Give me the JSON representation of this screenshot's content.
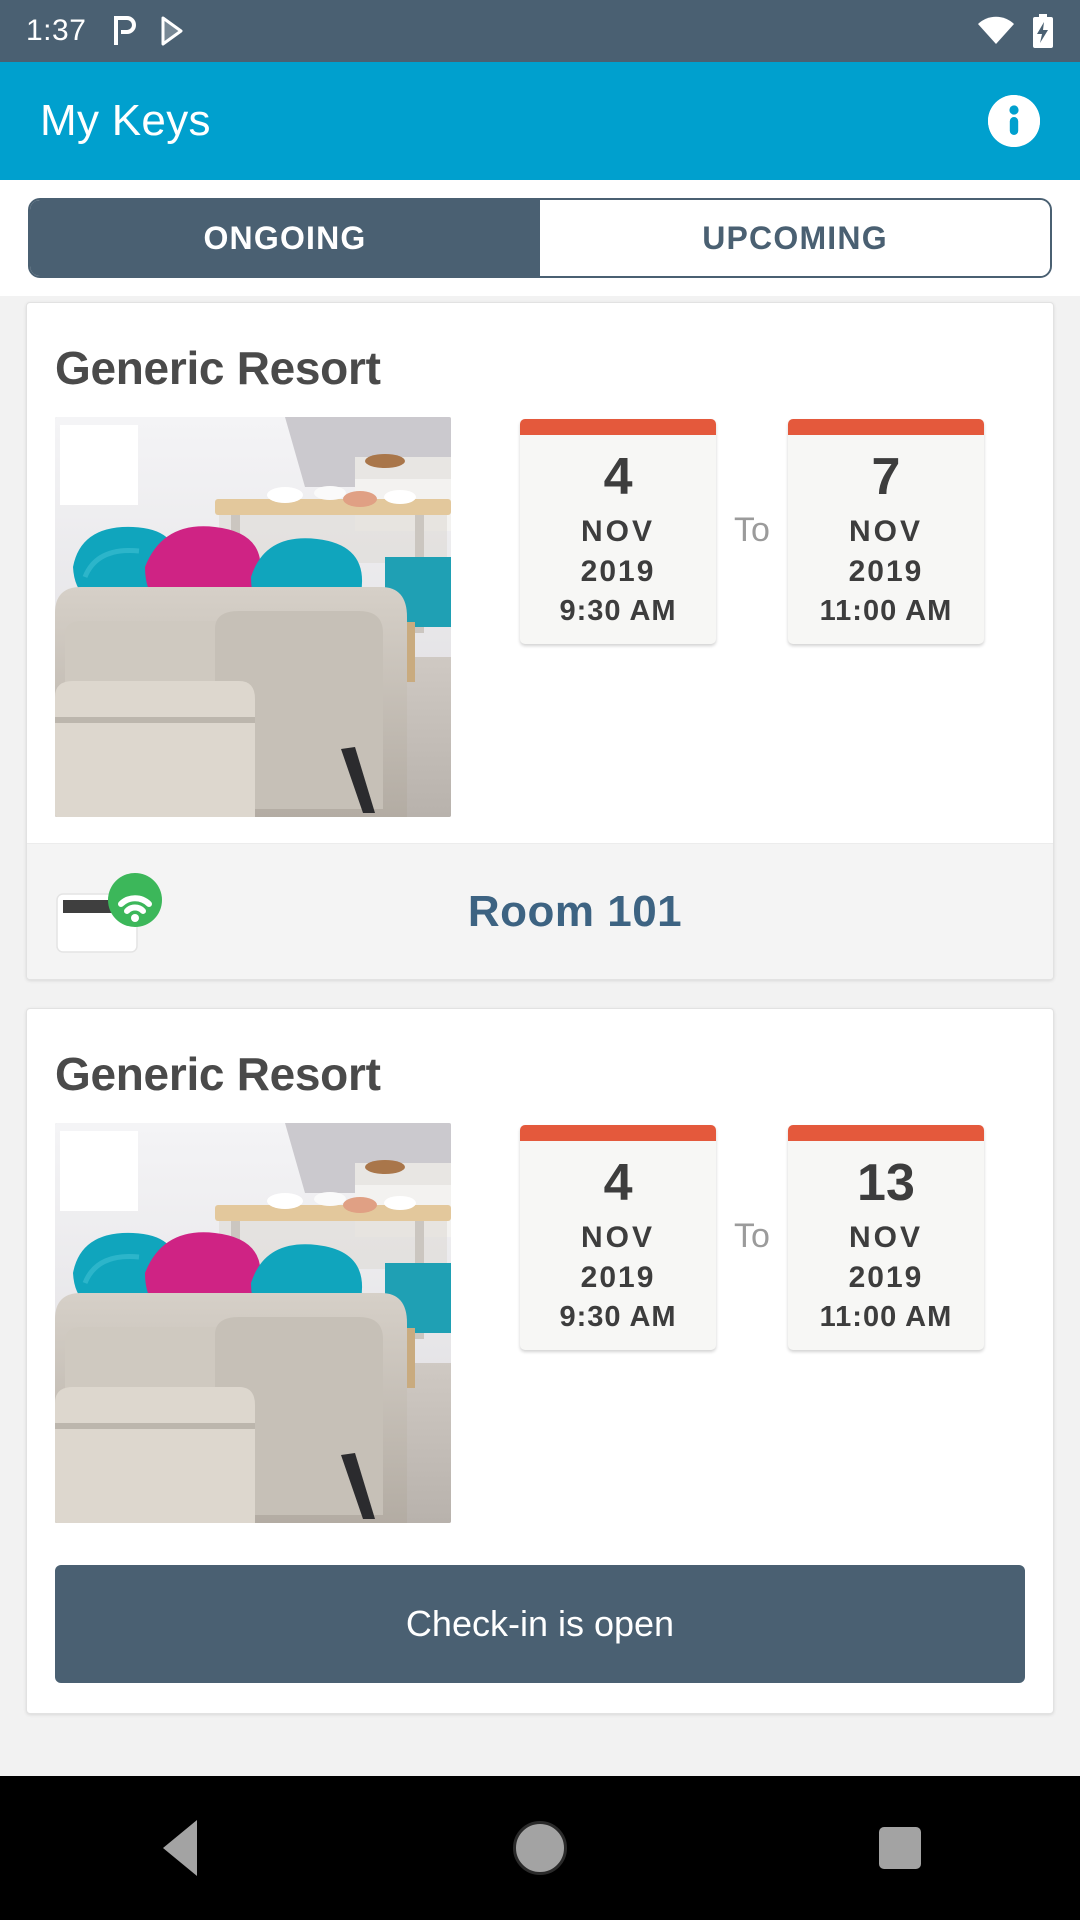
{
  "status_bar": {
    "time": "1:37",
    "left_icons": [
      "pocket-casts-icon",
      "play-store-icon"
    ],
    "right_icons": [
      "wifi-icon",
      "battery-charging-icon"
    ]
  },
  "app_bar": {
    "title": "My Keys",
    "info_icon": "info-icon",
    "background_color": "#00a0ce"
  },
  "tabs": {
    "items": [
      {
        "label": "ONGOING",
        "selected": true
      },
      {
        "label": "UPCOMING",
        "selected": false
      }
    ],
    "selected_color": "#4a6072",
    "unselected_text_color": "#4a6072"
  },
  "bookings": [
    {
      "property_name": "Generic Resort",
      "thumbnail": "living-room-photo",
      "separator_label": "To",
      "start": {
        "day": "4",
        "month": "NOV",
        "year": "2019",
        "time": "9:30 AM"
      },
      "end": {
        "day": "7",
        "month": "NOV",
        "year": "2019",
        "time": "11:00 AM"
      },
      "key": {
        "icon": "keycard-nfc-icon",
        "room_label": "Room 101"
      }
    },
    {
      "property_name": "Generic Resort",
      "thumbnail": "living-room-photo",
      "separator_label": "To",
      "start": {
        "day": "4",
        "month": "NOV",
        "year": "2019",
        "time": "9:30 AM"
      },
      "end": {
        "day": "13",
        "month": "NOV",
        "year": "2019",
        "time": "11:00 AM"
      },
      "action": {
        "label": "Check-in is open"
      }
    }
  ],
  "nav_bar": {
    "back": "back-triangle-icon",
    "home": "home-circle-icon",
    "recents": "recents-square-icon"
  },
  "colors": {
    "accent": "#00a0ce",
    "slate": "#4a6072",
    "calendar_strip": "#e4593c",
    "key_badge_green": "#3cb75a",
    "room_label": "#3d6382"
  }
}
